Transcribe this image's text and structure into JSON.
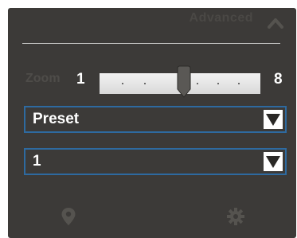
{
  "header": {
    "title": "Advanced",
    "collapse_icon": "chevron-up-icon"
  },
  "zoom": {
    "label": "Zoom",
    "min_label": "1",
    "max_label": "8",
    "value": 5,
    "min": 1,
    "max": 8
  },
  "preset_select": {
    "value": "Preset",
    "arrow_icon": "triangle-down-icon"
  },
  "number_select": {
    "value": "1",
    "arrow_icon": "triangle-down-icon"
  },
  "footer": {
    "location_icon": "map-pin-icon",
    "settings_icon": "gear-icon"
  },
  "colors": {
    "panel_bg": "#3c3a38",
    "select_border": "#2e6aa0",
    "text": "#ffffff"
  }
}
